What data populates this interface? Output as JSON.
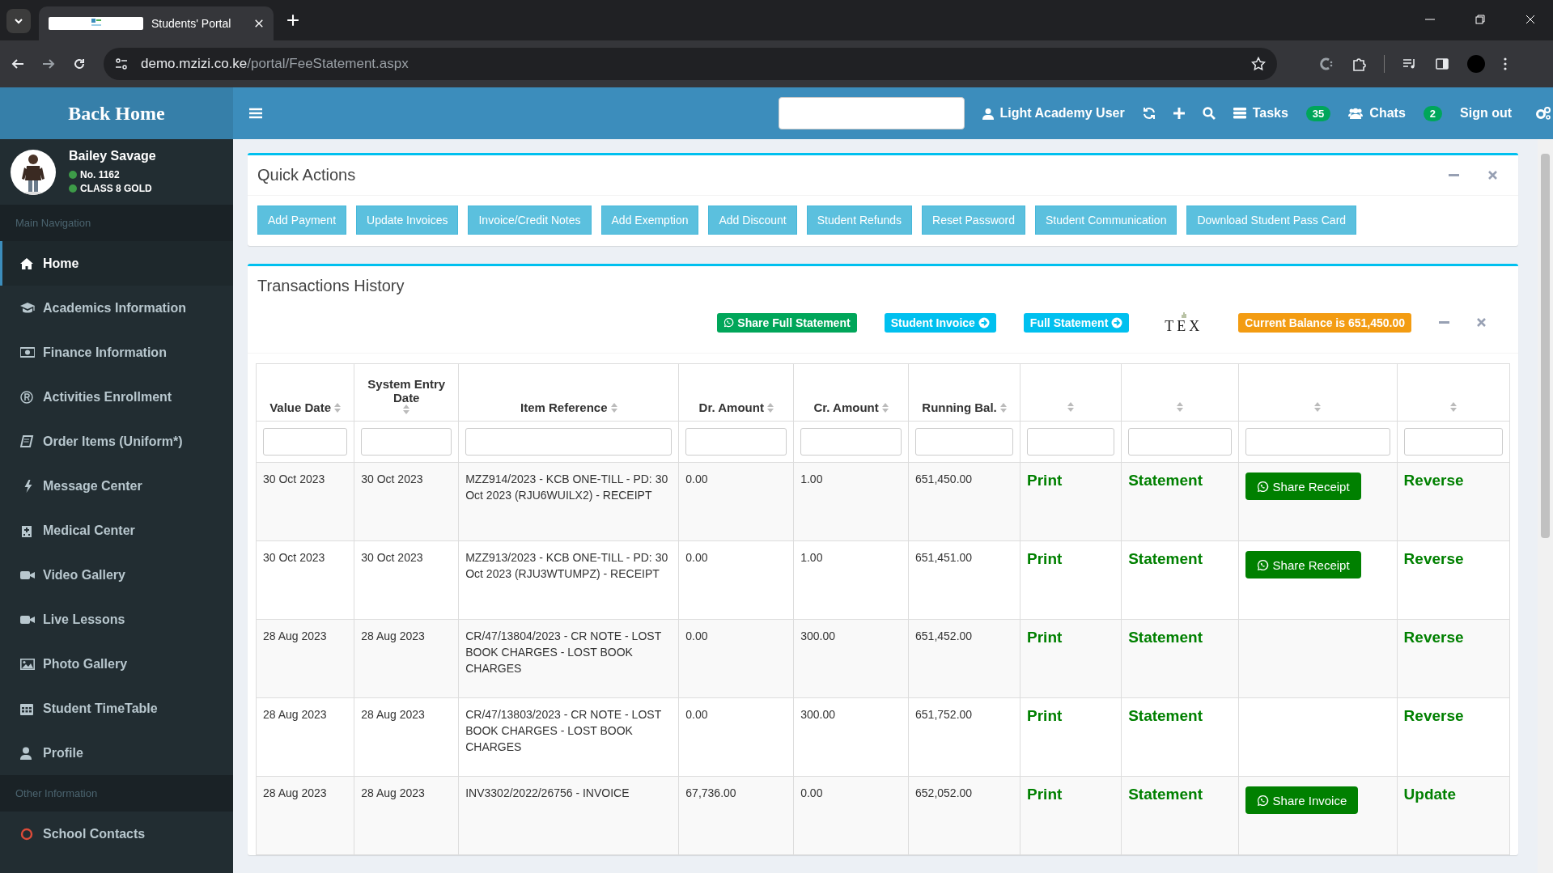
{
  "browser": {
    "tabs": [
      {
        "title": "Students' Portal",
        "selected": true
      }
    ],
    "url": {
      "domain": "demo.mzizi.co.ke",
      "path": "/portal/FeeStatement.aspx"
    }
  },
  "header": {
    "brand": "Back Home",
    "user": "Light Academy User",
    "tasks": {
      "label": "Tasks",
      "count": "35"
    },
    "chats": {
      "label": "Chats",
      "count": "2"
    },
    "sign_out": "Sign out"
  },
  "sidebar": {
    "profile": {
      "name": "Bailey Savage",
      "number": "No. 1162",
      "class": "CLASS 8 GOLD"
    },
    "sections": [
      {
        "title": "Main Navigation",
        "items": [
          {
            "label": "Home",
            "selected": true
          },
          {
            "label": "Academics Information",
            "selected": false
          },
          {
            "label": "Finance Information",
            "selected": false
          },
          {
            "label": "Activities Enrollment",
            "selected": false
          },
          {
            "label": "Order Items (Uniform*)",
            "selected": false
          },
          {
            "label": "Message Center",
            "selected": false
          },
          {
            "label": "Medical Center",
            "selected": false
          },
          {
            "label": "Video Gallery",
            "selected": false
          },
          {
            "label": "Live Lessons",
            "selected": false
          },
          {
            "label": "Photo Gallery",
            "selected": false
          },
          {
            "label": "Student TimeTable",
            "selected": false
          },
          {
            "label": "Profile",
            "selected": false
          }
        ]
      },
      {
        "title": "Other Information",
        "items": [
          {
            "label": "School Contacts",
            "selected": false
          }
        ]
      }
    ]
  },
  "quick_actions": {
    "title": "Quick Actions",
    "buttons": [
      "Add Payment",
      "Update Invoices",
      "Invoice/Credit Notes",
      "Add Exemption",
      "Add Discount",
      "Student Refunds",
      "Reset Password",
      "Student Communication",
      "Download Student Pass Card"
    ]
  },
  "transactions": {
    "title": "Transactions History",
    "actions": [
      {
        "kind": "share",
        "label": "Share Full Statement"
      },
      {
        "kind": "link",
        "label": "Student Invoice"
      },
      {
        "kind": "link",
        "label": "Full Statement"
      },
      {
        "kind": "logo",
        "label": "TEX"
      }
    ],
    "balance": "Current Balance is 651,450.00",
    "columns": [
      {
        "label": "Value Date",
        "sortable": true
      },
      {
        "label": "System Entry Date",
        "sortable": true
      },
      {
        "label": "Item Reference",
        "sortable": true
      },
      {
        "label": "Dr. Amount",
        "sortable": true
      },
      {
        "label": "Cr. Amount",
        "sortable": true
      },
      {
        "label": "Running Bal.",
        "sortable": true
      },
      {
        "sortable": true
      },
      {
        "sortable": true
      },
      {
        "sortable": true
      },
      {
        "sortable": true
      }
    ],
    "rows": [
      {
        "value_date": "30 Oct 2023",
        "entry_date": "30 Oct 2023",
        "reference": "MZZ914/2023 - KCB ONE-TILL - PD: 30 Oct 2023 (RJU6WUILX2) - RECEIPT",
        "dr": "0.00",
        "cr": "1.00",
        "balance": "651,450.00",
        "print": "Print",
        "statement": "Statement",
        "share": "Share Receipt",
        "action": "Reverse"
      },
      {
        "value_date": "30 Oct 2023",
        "entry_date": "30 Oct 2023",
        "reference": "MZZ913/2023 - KCB ONE-TILL - PD: 30 Oct 2023 (RJU3WTUMPZ) - RECEIPT",
        "dr": "0.00",
        "cr": "1.00",
        "balance": "651,451.00",
        "print": "Print",
        "statement": "Statement",
        "share": "Share Receipt",
        "action": "Reverse"
      },
      {
        "value_date": "28 Aug 2023",
        "entry_date": "28 Aug 2023",
        "reference": "CR/47/13804/2023 - CR NOTE - LOST BOOK CHARGES - LOST BOOK CHARGES",
        "dr": "0.00",
        "cr": "300.00",
        "balance": "651,452.00",
        "print": "Print",
        "statement": "Statement",
        "action": "Reverse"
      },
      {
        "value_date": "28 Aug 2023",
        "entry_date": "28 Aug 2023",
        "reference": "CR/47/13803/2023 - CR NOTE - LOST BOOK CHARGES - LOST BOOK CHARGES",
        "dr": "0.00",
        "cr": "300.00",
        "balance": "651,752.00",
        "print": "Print",
        "statement": "Statement",
        "action": "Reverse"
      },
      {
        "value_date": "28 Aug 2023",
        "entry_date": "28 Aug 2023",
        "reference": "INV3302/2022/26756 - INVOICE",
        "dr": "67,736.00",
        "cr": "0.00",
        "balance": "652,052.00",
        "print": "Print",
        "statement": "Statement",
        "share": "Share Invoice",
        "action": "Update"
      }
    ]
  }
}
